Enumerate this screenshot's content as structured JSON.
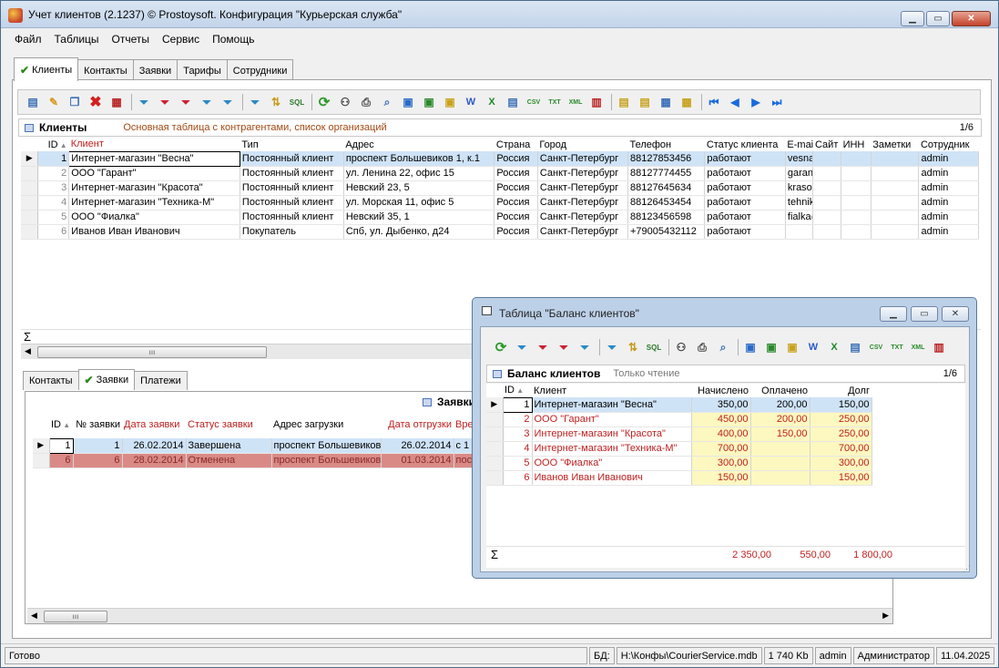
{
  "window": {
    "title": "Учет клиентов (2.1237) © Prostoysoft. Конфигурация \"Курьерская служба\""
  },
  "menu": [
    "Файл",
    "Таблицы",
    "Отчеты",
    "Сервис",
    "Помощь"
  ],
  "tabs": [
    "Клиенты",
    "Контакты",
    "Заявки",
    "Тарифы",
    "Сотрудники"
  ],
  "clients": {
    "title": "Клиенты",
    "subtitle": "Основная таблица с контрагентами, список организаций",
    "count": "1/6",
    "columns": [
      "ID",
      "Клиент",
      "Тип",
      "Адрес",
      "Страна",
      "Город",
      "Телефон",
      "Статус клиента",
      "E-mail",
      "Сайт",
      "ИНН",
      "Заметки",
      "Сотрудник"
    ],
    "rows": [
      [
        "1",
        "Интернет-магазин \"Весна\"",
        "Постоянный клиент",
        "проспект Большевиков 1, к.1",
        "Россия",
        "Санкт-Петербург",
        "88127853456",
        "работают",
        "vesna@mail.ru",
        "",
        "",
        "",
        "admin"
      ],
      [
        "2",
        "ООО \"Гарант\"",
        "Постоянный клиент",
        "ул. Ленина 22, офис 15",
        "Россия",
        "Санкт-Петербург",
        "88127774455",
        "работают",
        "garant@mail.ru",
        "",
        "",
        "",
        "admin"
      ],
      [
        "3",
        "Интернет-магазин \"Красота\"",
        "Постоянный клиент",
        "Невский 23, 5",
        "Россия",
        "Санкт-Петербург",
        "88127645634",
        "работают",
        "krasota@mail.ru",
        "",
        "",
        "",
        "admin"
      ],
      [
        "4",
        "Интернет-магазин \"Техника-М\"",
        "Постоянный клиент",
        "ул. Морская 11, офис 5",
        "Россия",
        "Санкт-Петербург",
        "88126453454",
        "работают",
        "tehnika@mail.ru",
        "",
        "",
        "",
        "admin"
      ],
      [
        "5",
        "ООО \"Фиалка\"",
        "Постоянный клиент",
        "Невский 35, 1",
        "Россия",
        "Санкт-Петербург",
        "88123456598",
        "работают",
        "fialka@mail.ru",
        "",
        "",
        "",
        "admin"
      ],
      [
        "6",
        "Иванов Иван Иванович",
        "Покупатель",
        "Спб, ул. Дыбенко, д24",
        "Россия",
        "Санкт-Петербург",
        "+79005432112",
        "работают",
        "",
        "",
        "",
        "",
        "admin"
      ]
    ],
    "sigma": "Σ"
  },
  "subtabs": [
    "Контакты",
    "Заявки",
    "Платежи"
  ],
  "orders": {
    "title": "Заявки",
    "columns": [
      "ID",
      "№ заявки",
      "Дата заявки",
      "Статус заявки",
      "Адрес загрузки",
      "Дата отгрузки",
      "Вре"
    ],
    "rows": [
      [
        "1",
        "1",
        "26.02.2014",
        "Завершена",
        "проспект Большевиков",
        "26.02.2014",
        "с 1"
      ],
      [
        "6",
        "6",
        "28.02.2014",
        "Отменена",
        "проспект Большевиков",
        "01.03.2014",
        "пос"
      ]
    ]
  },
  "balance": {
    "window_title": "Таблица \"Баланс клиентов\"",
    "title": "Баланс клиентов",
    "subtitle": "Только чтение",
    "count": "1/6",
    "columns": [
      "ID",
      "Клиент",
      "Начислено",
      "Оплачено",
      "Долг"
    ],
    "rows": [
      [
        "1",
        "Интернет-магазин \"Весна\"",
        "350,00",
        "200,00",
        "150,00"
      ],
      [
        "2",
        "ООО \"Гарант\"",
        "450,00",
        "200,00",
        "250,00"
      ],
      [
        "3",
        "Интернет-магазин \"Красота\"",
        "400,00",
        "150,00",
        "250,00"
      ],
      [
        "4",
        "Интернет-магазин \"Техника-М\"",
        "700,00",
        "",
        "700,00"
      ],
      [
        "5",
        "ООО \"Фиалка\"",
        "300,00",
        "",
        "300,00"
      ],
      [
        "6",
        "Иванов Иван Иванович",
        "150,00",
        "",
        "150,00"
      ]
    ],
    "totals": [
      "2 350,00",
      "550,00",
      "1 800,00"
    ]
  },
  "status": {
    "left": "Готово",
    "db_label": "БД:",
    "db_path": "H:\\Конфы\\CourierService.mdb",
    "size": "1 740 Kb",
    "user": "admin",
    "role": "Администратор",
    "date": "11.04.2025"
  },
  "colors": {
    "accent_red": "#c02020",
    "subtitle_brown": "#a34a12",
    "selected_row": "#cfe3f7",
    "yellow_cell": "#fdf8c0"
  }
}
